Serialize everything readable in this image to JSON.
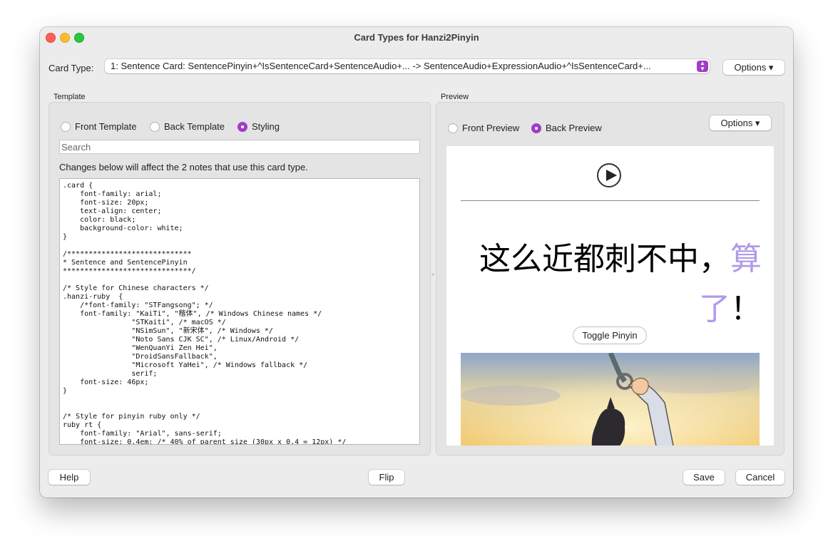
{
  "window": {
    "title": "Card Types for Hanzi2Pinyin"
  },
  "card_type": {
    "label": "Card Type:",
    "selected": "1: Sentence Card: SentencePinyin+^IsSentenceCard+SentenceAudio+... -> SentenceAudio+ExpressionAudio+^IsSentenceCard+...",
    "options_button": "Options ▾"
  },
  "template": {
    "section_label": "Template",
    "radios": [
      {
        "label": "Front Template",
        "selected": false
      },
      {
        "label": "Back Template",
        "selected": false
      },
      {
        "label": "Styling",
        "selected": true
      }
    ],
    "search_placeholder": "Search",
    "notice": "Changes below will affect the 2 notes that use this card type.",
    "code": ".card {\n    font-family: arial;\n    font-size: 20px;\n    text-align: center;\n    color: black;\n    background-color: white;\n}\n\n/*****************************\n* Sentence and SentencePinyin\n******************************/\n\n/* Style for Chinese characters */\n.hanzi-ruby  {\n    /*font-family: \"STFangsong\"; */\n    font-family: \"KaiTi\", \"楷体\", /* Windows Chinese names */\n                \"STKaiti\", /* macOS */\n                \"NSimSun\", \"新宋体\", /* Windows */\n                \"Noto Sans CJK SC\", /* Linux/Android */\n                \"WenQuanYi Zen Hei\",\n                \"DroidSansFallback\",\n                \"Microsoft YaHei\", /* Windows fallback */\n                serif;\n    font-size: 46px;\n}\n\n\n/* Style for pinyin ruby only */\nruby rt {\n    font-family: \"Arial\", sans-serif;\n    font-size: 0.4em; /* 40% of parent size (30px x 0.4 = 12px) */"
  },
  "preview": {
    "section_label": "Preview",
    "radios": [
      {
        "label": "Front Preview",
        "selected": false
      },
      {
        "label": "Back Preview",
        "selected": true
      }
    ],
    "options_button": "Options ▾",
    "sentence_main": "这么近都刺不中，",
    "sentence_highlight": "算了",
    "sentence_end": "！",
    "toggle_button": "Toggle Pinyin",
    "highlight_color": "#b09be8"
  },
  "footer": {
    "help": "Help",
    "flip": "Flip",
    "save": "Save",
    "cancel": "Cancel"
  },
  "colors": {
    "accent": "#a23cc8",
    "window_bg": "#ececec",
    "panel_bg": "#e4e4e4"
  }
}
